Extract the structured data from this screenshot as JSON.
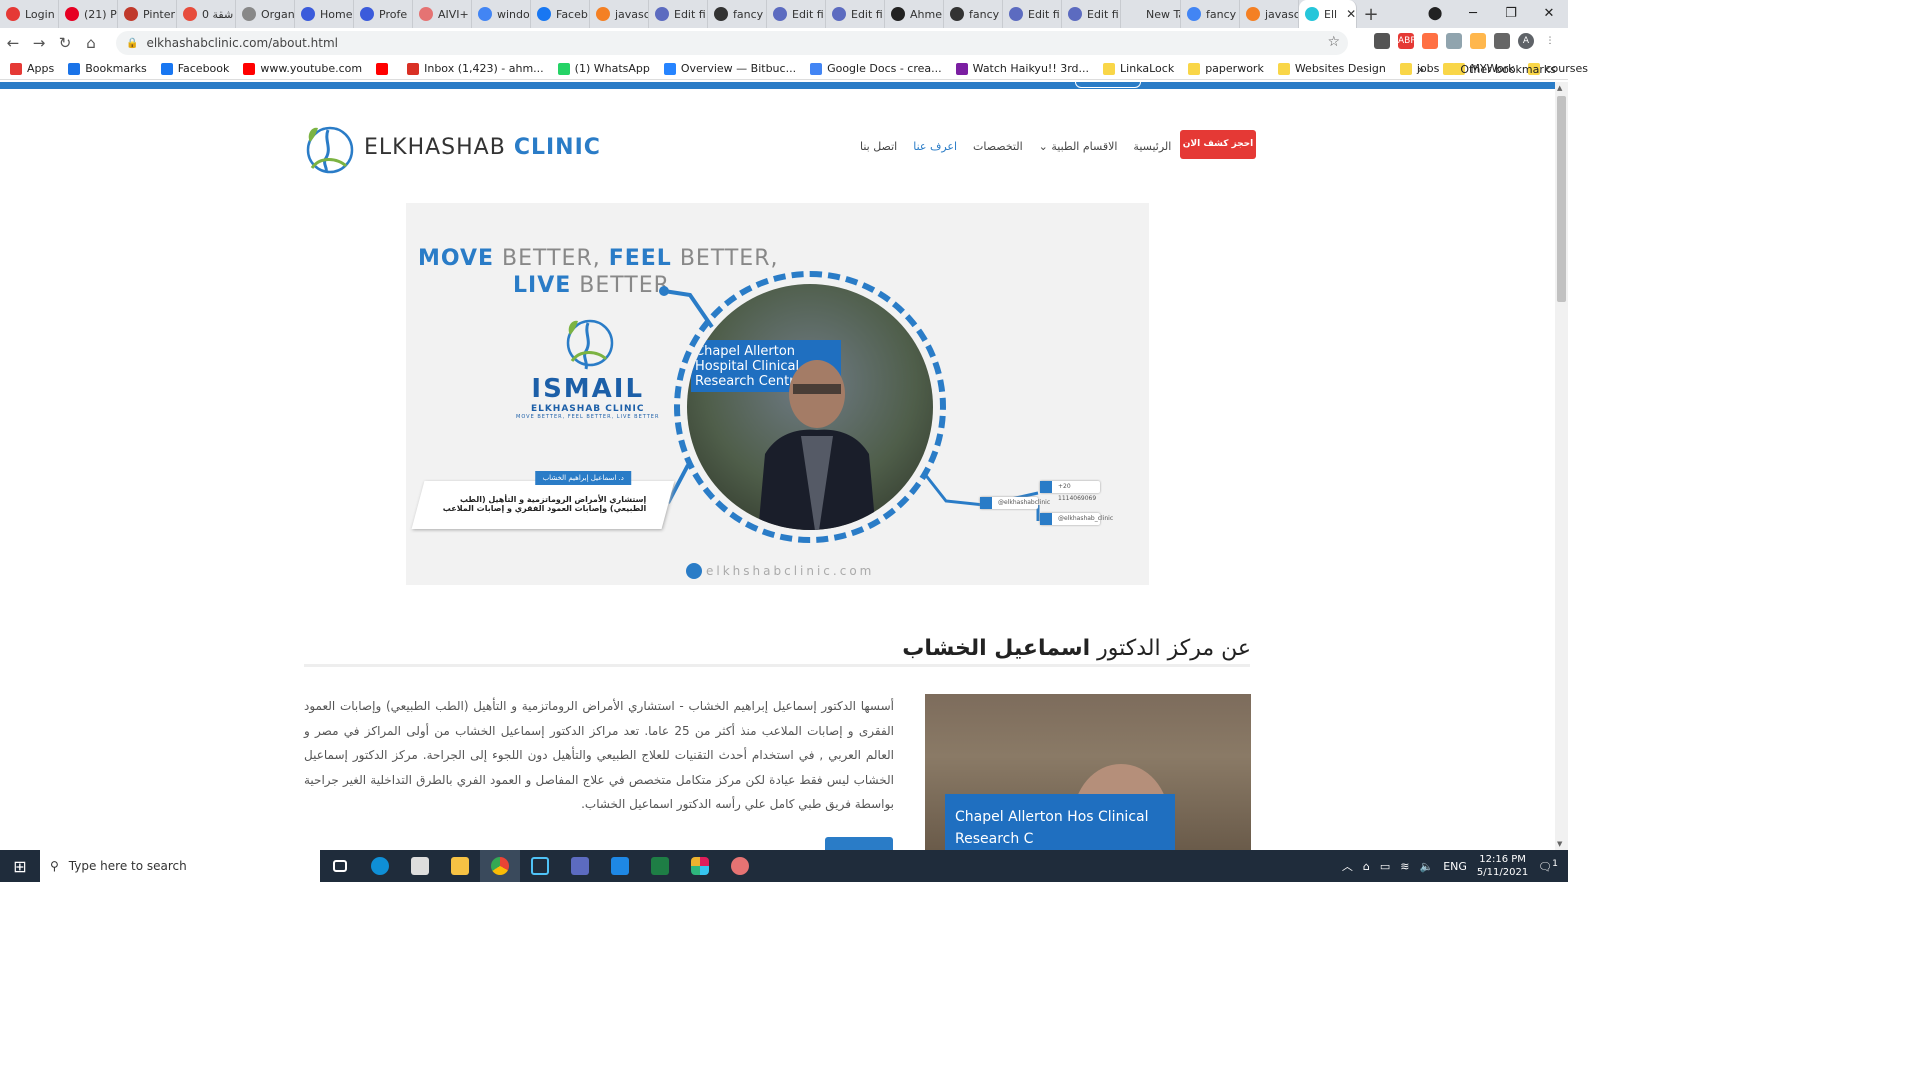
{
  "browser": {
    "tabs": [
      {
        "label": "Login",
        "color": "#e53935"
      },
      {
        "label": "(21) P",
        "color": "#e60023"
      },
      {
        "label": "Pinter",
        "color": "#c0392b"
      },
      {
        "label": "شقة 0",
        "color": "#e74c3c"
      },
      {
        "label": "Organ",
        "color": "#888888"
      },
      {
        "label": "Home",
        "color": "#3b5bdb"
      },
      {
        "label": "Profe",
        "color": "#3b5bdb"
      },
      {
        "label": "AIVI+",
        "color": "#e57373"
      },
      {
        "label": "windo",
        "color": "#4285f4"
      },
      {
        "label": "Faceb",
        "color": "#1877f2"
      },
      {
        "label": "javasc",
        "color": "#f48024"
      },
      {
        "label": "Edit fi",
        "color": "#5c6bc0"
      },
      {
        "label": "fancy",
        "color": "#333333"
      },
      {
        "label": "Edit fi",
        "color": "#5c6bc0"
      },
      {
        "label": "Edit fi",
        "color": "#5c6bc0"
      },
      {
        "label": "Ahme",
        "color": "#222222"
      },
      {
        "label": "fancy",
        "color": "#333333"
      },
      {
        "label": "Edit fi",
        "color": "#5c6bc0"
      },
      {
        "label": "Edit fi",
        "color": "#5c6bc0"
      },
      {
        "label": "New Tab",
        "color": "#dee1e6"
      },
      {
        "label": "fancy",
        "color": "#4285f4"
      },
      {
        "label": "javasc",
        "color": "#f48024"
      },
      {
        "label": "Ell",
        "color": "#26c6da"
      }
    ],
    "url": "elkhashabclinic.com/about.html",
    "bookmarks": [
      {
        "label": "Apps",
        "color": "#e53935"
      },
      {
        "label": "Bookmarks",
        "color": "#1a73e8"
      },
      {
        "label": "Facebook",
        "color": "#1877f2"
      },
      {
        "label": "www.youtube.com",
        "color": "#ff0000"
      },
      {
        "label": "",
        "color": "#ff0000"
      },
      {
        "label": "Inbox (1,423) - ahm...",
        "color": "#d93025"
      },
      {
        "label": "(1) WhatsApp",
        "color": "#25d366"
      },
      {
        "label": "Overview — Bitbuc...",
        "color": "#2684ff"
      },
      {
        "label": "Google Docs - crea...",
        "color": "#4285f4"
      },
      {
        "label": "Watch Haikyu!! 3rd...",
        "color": "#7b1fa2"
      },
      {
        "label": "LinkaLock",
        "color": "#f9d648"
      },
      {
        "label": "paperwork",
        "color": "#f9d648"
      },
      {
        "label": "Websites Design",
        "color": "#f9d648"
      },
      {
        "label": "jobs",
        "color": "#f9d648"
      },
      {
        "label": "MYWork",
        "color": "#f9d648"
      },
      {
        "label": "courses",
        "color": "#f9d648"
      }
    ],
    "other_bookmarks": "Other bookmarks",
    "chevron": "»"
  },
  "site": {
    "logo_text_a": "ELKHASHAB ",
    "logo_text_b": "CLINIC",
    "nav": [
      {
        "label": "الرئيسية",
        "active": false
      },
      {
        "label": "الاقسام الطبية",
        "active": false,
        "dropdown": true
      },
      {
        "label": "التخصصات",
        "active": false
      },
      {
        "label": "اعرف عنا",
        "active": true
      },
      {
        "label": "اتصل بنا",
        "active": false
      }
    ],
    "cta": "احجز كشف الان",
    "hero": {
      "slogan_a1": "MOVE",
      "slogan_a2": " BETTER, ",
      "slogan_a3": "FEEL",
      "slogan_a4": " BETTER,",
      "slogan_b1": "LIVE",
      "slogan_b2": " BETTER",
      "brand_big": "ISMAIL",
      "brand_sm": "ELKHASHAB CLINIC",
      "brand_tiny": "MOVE BETTER, FEEL BETTER, LIVE BETTER",
      "sign_text": "Chapel Allerton Hospital Clinical Research Centre",
      "card_title": "د. اسماعيل إبراهيم الخشاب",
      "card_body": "إستشاري الأمراض الروماتزمية و التأهيل (الطب الطبيعي) وإصابات العمود الفقري و إصابات الملاعب",
      "social_whatsapp": "+20 1114069069",
      "social_facebook": "@elkhashabclinic",
      "social_instagram": "@elkhashab_clinic",
      "site": "elkhshabclinic.com"
    },
    "about": {
      "title_a": "عن مركز الدكتور ",
      "title_b": "اسماعيل الخشاب",
      "text": "أسسها الدكتور إسماعيل إبراهيم الخشاب - استشاري الأمراض الروماتزمية و التأهيل (الطب الطبيعي) وإصابات العمود الفقرى و إصابات الملاعب منذ أكثر من 25 عاما. تعد مراكز الدكتور إسماعيل الخشاب من أولى المراكز في مصر و العالم العربي , في استخدام أحدث التقنيات للعلاج الطبيعي والتأهيل دون اللجوء إلى الجراحة. مركز الدكتور إسماعيل الخشاب ليس فقط عيادة لكن مركز متكامل متخصص في علاج المفاصل و العمود الفري بالطرق التداخلية الغير جراحية بواسطة فريق طبي كامل علي رأسه الدكتور اسماعيل الخشاب.",
      "sign_text": "Chapel Allerton Hos Clinical Research C"
    }
  },
  "taskbar": {
    "search_placeholder": "Type here to search",
    "lang": "ENG",
    "time": "12:16 PM",
    "date": "5/11/2021",
    "notifications": "1"
  }
}
